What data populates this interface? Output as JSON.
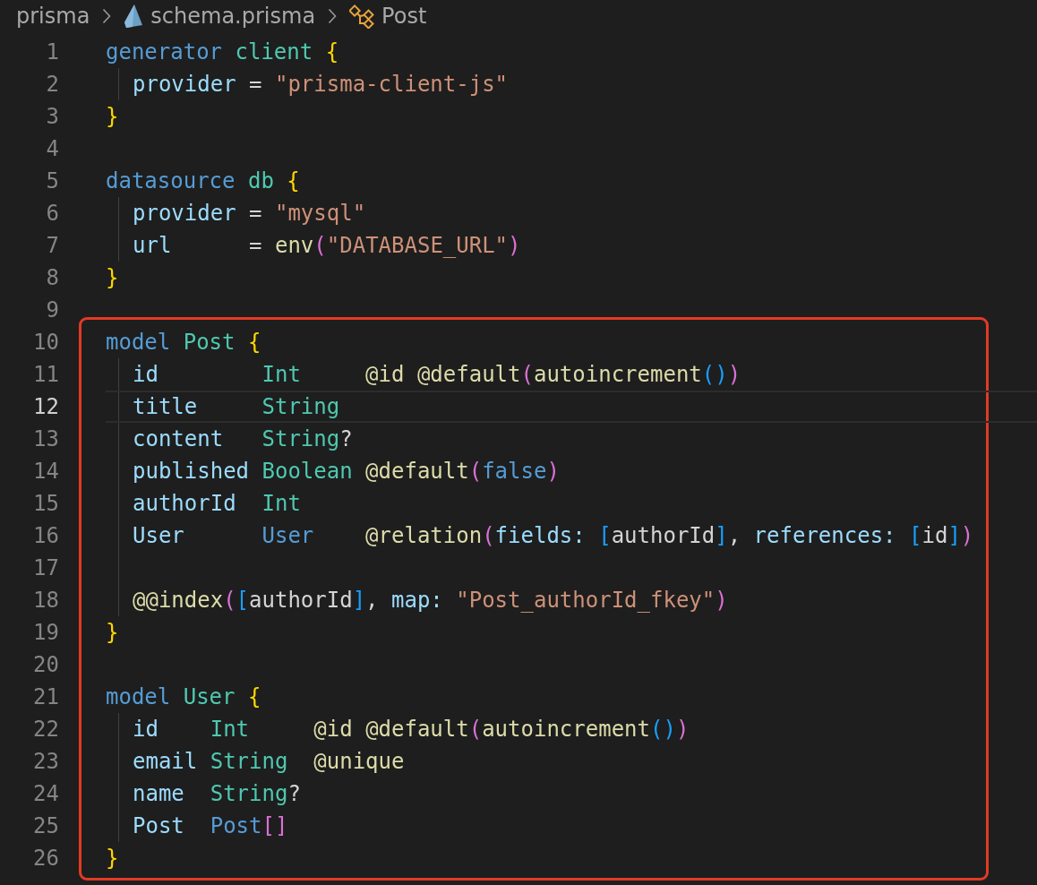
{
  "breadcrumb": [
    {
      "kind": "folder",
      "label": "prisma"
    },
    {
      "kind": "file",
      "label": "schema.prisma"
    },
    {
      "kind": "symbol",
      "label": "Post"
    }
  ],
  "lines": [
    {
      "number": "1",
      "current": false,
      "indent": false,
      "boxed": false,
      "tokens": [
        {
          "t": "generator",
          "kind": "kw"
        },
        {
          "t": " client",
          "kind": "name"
        },
        {
          "t": " {",
          "kind": "b1"
        }
      ]
    },
    {
      "number": "2",
      "current": false,
      "indent": true,
      "boxed": false,
      "tokens": [
        {
          "t": "provider",
          "kind": "field"
        },
        {
          "t": " =",
          "kind": "op"
        },
        {
          "t": " \"prisma-client-js\"",
          "kind": "str"
        }
      ]
    },
    {
      "number": "3",
      "current": false,
      "indent": false,
      "boxed": false,
      "tokens": [
        {
          "t": "}",
          "kind": "b1"
        }
      ]
    },
    {
      "number": "4",
      "current": false,
      "indent": false,
      "boxed": false
    },
    {
      "number": "5",
      "current": false,
      "indent": false,
      "boxed": false,
      "tokens": [
        {
          "t": "datasource",
          "kind": "kw"
        },
        {
          "t": " db",
          "kind": "name"
        },
        {
          "t": " {",
          "kind": "b1"
        }
      ]
    },
    {
      "number": "6",
      "current": false,
      "indent": true,
      "boxed": false,
      "tokens": [
        {
          "t": "provider",
          "kind": "field"
        },
        {
          "t": " =",
          "kind": "op"
        },
        {
          "t": " \"mysql\"",
          "kind": "str"
        }
      ]
    },
    {
      "number": "7",
      "current": false,
      "indent": true,
      "boxed": false,
      "tokens": [
        {
          "t": "url",
          "kind": "field"
        },
        {
          "t": "      =",
          "kind": "op"
        },
        {
          "t": " env",
          "kind": "fn"
        },
        {
          "t": "(",
          "kind": "b2"
        },
        {
          "t": "\"DATABASE_URL\"",
          "kind": "str"
        },
        {
          "t": ")",
          "kind": "b2"
        }
      ]
    },
    {
      "number": "8",
      "current": false,
      "indent": false,
      "boxed": false,
      "tokens": [
        {
          "t": "}",
          "kind": "b1"
        }
      ]
    },
    {
      "number": "9",
      "current": false,
      "indent": false,
      "boxed": false
    },
    {
      "number": "10",
      "current": false,
      "indent": false,
      "boxed": true,
      "tokens": [
        {
          "t": "model",
          "kind": "kw"
        },
        {
          "t": " Post",
          "kind": "name"
        },
        {
          "t": " {",
          "kind": "b1"
        }
      ]
    },
    {
      "number": "11",
      "current": false,
      "indent": true,
      "boxed": true,
      "tokens": [
        {
          "t": "id",
          "kind": "field"
        },
        {
          "t": "        Int",
          "kind": "type"
        },
        {
          "t": "     @id",
          "kind": "attr"
        },
        {
          "t": " @default",
          "kind": "attr"
        },
        {
          "t": "(",
          "kind": "b2"
        },
        {
          "t": "autoincrement",
          "kind": "fn"
        },
        {
          "t": "()",
          "kind": "b3"
        },
        {
          "t": ")",
          "kind": "b2"
        }
      ]
    },
    {
      "number": "12",
      "current": true,
      "indent": true,
      "boxed": true,
      "tokens": [
        {
          "t": "title",
          "kind": "field"
        },
        {
          "t": "     String",
          "kind": "type"
        }
      ]
    },
    {
      "number": "13",
      "current": false,
      "indent": true,
      "boxed": true,
      "tokens": [
        {
          "t": "content",
          "kind": "field"
        },
        {
          "t": "   String",
          "kind": "type"
        },
        {
          "t": "?",
          "kind": "op"
        }
      ]
    },
    {
      "number": "14",
      "current": false,
      "indent": true,
      "boxed": true,
      "tokens": [
        {
          "t": "published",
          "kind": "field"
        },
        {
          "t": " Boolean",
          "kind": "type"
        },
        {
          "t": " @default",
          "kind": "attr"
        },
        {
          "t": "(",
          "kind": "b2"
        },
        {
          "t": "false",
          "kind": "bool"
        },
        {
          "t": ")",
          "kind": "b2"
        }
      ]
    },
    {
      "number": "15",
      "current": false,
      "indent": true,
      "boxed": true,
      "tokens": [
        {
          "t": "authorId",
          "kind": "field"
        },
        {
          "t": "  Int",
          "kind": "type"
        }
      ]
    },
    {
      "number": "16",
      "current": false,
      "indent": true,
      "boxed": true,
      "tokens": [
        {
          "t": "User",
          "kind": "field"
        },
        {
          "t": "      User",
          "kind": "typeref"
        },
        {
          "t": "    @relation",
          "kind": "attr"
        },
        {
          "t": "(",
          "kind": "b2"
        },
        {
          "t": "fields:",
          "kind": "arg"
        },
        {
          "t": " [",
          "kind": "b3"
        },
        {
          "t": "authorId",
          "kind": "plain"
        },
        {
          "t": "]",
          "kind": "b3"
        },
        {
          "t": ",",
          "kind": "op"
        },
        {
          "t": " references:",
          "kind": "arg"
        },
        {
          "t": " [",
          "kind": "b3"
        },
        {
          "t": "id",
          "kind": "plain"
        },
        {
          "t": "]",
          "kind": "b3"
        },
        {
          "t": ")",
          "kind": "b2"
        }
      ]
    },
    {
      "number": "17",
      "current": false,
      "indent": true,
      "boxed": true
    },
    {
      "number": "18",
      "current": false,
      "indent": true,
      "boxed": true,
      "tokens": [
        {
          "t": "@@index",
          "kind": "attr"
        },
        {
          "t": "(",
          "kind": "b2"
        },
        {
          "t": "[",
          "kind": "b3"
        },
        {
          "t": "authorId",
          "kind": "plain"
        },
        {
          "t": "]",
          "kind": "b3"
        },
        {
          "t": ",",
          "kind": "op"
        },
        {
          "t": " map:",
          "kind": "arg"
        },
        {
          "t": " \"Post_authorId_fkey\"",
          "kind": "str"
        },
        {
          "t": ")",
          "kind": "b2"
        }
      ]
    },
    {
      "number": "19",
      "current": false,
      "indent": false,
      "boxed": true,
      "tokens": [
        {
          "t": "}",
          "kind": "b1"
        }
      ]
    },
    {
      "number": "20",
      "current": false,
      "indent": false,
      "boxed": true
    },
    {
      "number": "21",
      "current": false,
      "indent": false,
      "boxed": true,
      "tokens": [
        {
          "t": "model",
          "kind": "kw"
        },
        {
          "t": " User",
          "kind": "name"
        },
        {
          "t": " {",
          "kind": "b1"
        }
      ]
    },
    {
      "number": "22",
      "current": false,
      "indent": true,
      "boxed": true,
      "tokens": [
        {
          "t": "id",
          "kind": "field"
        },
        {
          "t": "    Int",
          "kind": "type"
        },
        {
          "t": "     @id",
          "kind": "attr"
        },
        {
          "t": " @default",
          "kind": "attr"
        },
        {
          "t": "(",
          "kind": "b2"
        },
        {
          "t": "autoincrement",
          "kind": "fn"
        },
        {
          "t": "()",
          "kind": "b3"
        },
        {
          "t": ")",
          "kind": "b2"
        }
      ]
    },
    {
      "number": "23",
      "current": false,
      "indent": true,
      "boxed": true,
      "tokens": [
        {
          "t": "email",
          "kind": "field"
        },
        {
          "t": " String",
          "kind": "type"
        },
        {
          "t": "  @unique",
          "kind": "attr"
        }
      ]
    },
    {
      "number": "24",
      "current": false,
      "indent": true,
      "boxed": true,
      "tokens": [
        {
          "t": "name",
          "kind": "field"
        },
        {
          "t": "  String",
          "kind": "type"
        },
        {
          "t": "?",
          "kind": "op"
        }
      ]
    },
    {
      "number": "25",
      "current": false,
      "indent": true,
      "boxed": true,
      "tokens": [
        {
          "t": "Post",
          "kind": "field"
        },
        {
          "t": "  Post",
          "kind": "typeref"
        },
        {
          "t": "[]",
          "kind": "b2"
        }
      ]
    },
    {
      "number": "26",
      "current": false,
      "indent": false,
      "boxed": true,
      "tokens": [
        {
          "t": "}",
          "kind": "b1"
        }
      ]
    }
  ]
}
